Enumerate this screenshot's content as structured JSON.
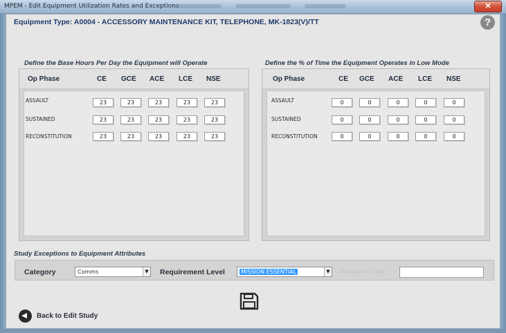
{
  "window": {
    "title": "MPEM - Edit Equipment Utilization Rates and Exceptions",
    "close_glyph": "✕"
  },
  "header": {
    "equipment_type": "Equipment Type: A0004 - ACCESSORY MAINTENANCE KIT, TELEPHONE, MK-1823(V)/TT",
    "help_glyph": "?"
  },
  "base_hours": {
    "heading": "Define the Base Hours Per Day the Equipment will Operate",
    "columns": [
      "Op Phase",
      "CE",
      "GCE",
      "ACE",
      "LCE",
      "NSE"
    ],
    "rows": [
      {
        "phase": "ASSAULT",
        "values": [
          "23",
          "23",
          "23",
          "23",
          "23"
        ]
      },
      {
        "phase": "SUSTAINED",
        "values": [
          "23",
          "23",
          "23",
          "23",
          "23"
        ]
      },
      {
        "phase": "RECONSTITUTION",
        "values": [
          "23",
          "23",
          "23",
          "23",
          "23"
        ]
      }
    ]
  },
  "low_mode": {
    "heading": "Define the % of Time the Equipment Operates in Low Mode",
    "columns": [
      "Op Phase",
      "CE",
      "GCE",
      "ACE",
      "LCE",
      "NSE"
    ],
    "rows": [
      {
        "phase": "ASSAULT",
        "values": [
          "0",
          "0",
          "0",
          "0",
          "0"
        ]
      },
      {
        "phase": "SUSTAINED",
        "values": [
          "0",
          "0",
          "0",
          "0",
          "0"
        ]
      },
      {
        "phase": "RECONSTITUTION",
        "values": [
          "0",
          "0",
          "0",
          "0",
          "0"
        ]
      }
    ]
  },
  "exceptions": {
    "heading": "Study Exceptions to Equipment Attributes",
    "category_label": "Category",
    "category_value": "Comms",
    "requirement_label": "Requirement Level",
    "requirement_value": "MISSION ESSENTIAL",
    "standard_load_label": "Standard Load",
    "standard_load_value": ""
  },
  "footer": {
    "back_label": "Back to Edit Study",
    "save_icon": "floppy-disk-icon"
  }
}
